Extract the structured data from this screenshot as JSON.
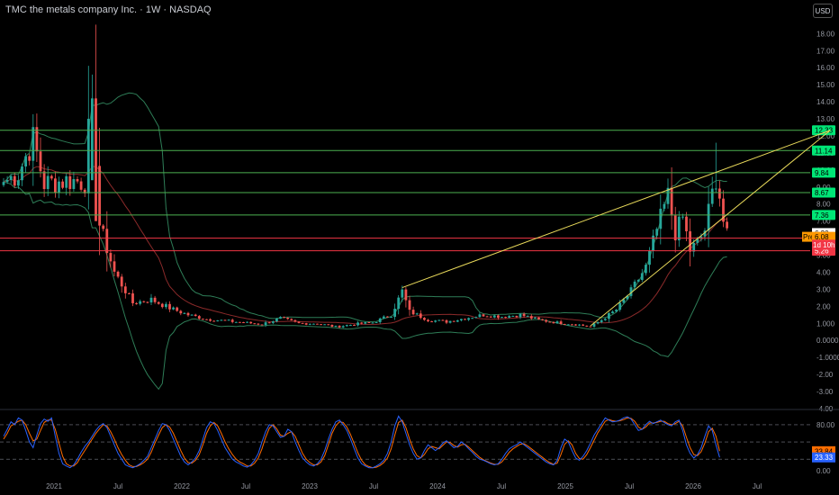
{
  "header": {
    "title": "TMC the metals company Inc. · 1W · NASDAQ",
    "currency_button": "USD"
  },
  "colors": {
    "background": "#000000",
    "level_line": "#4caf50",
    "level_label_bg": "#00e676",
    "red_line": "#f23645",
    "trend_line": "#e8d95a",
    "candle_up": "#26a69a",
    "candle_down": "#ef5350",
    "bb_band": "#2e7d57",
    "basis": "#8b2a2a",
    "stoch_k": "#2962ff",
    "stoch_d": "#ff6d00",
    "pre_label": "#ff9800"
  },
  "chart_data": {
    "type": "candlestick",
    "timeframe": "1W",
    "x_ticks": [
      "2021",
      "Jul",
      "2022",
      "Jul",
      "2023",
      "Jul",
      "2024",
      "Jul",
      "2025",
      "Jul",
      "2026",
      "Jul"
    ],
    "y_ticks": [
      "18.00",
      "17.00",
      "16.00",
      "15.00",
      "14.00",
      "13.00",
      "12.00",
      "11.00",
      "10.00",
      "9.00",
      "8.00",
      "7.00",
      "6.00",
      "5.00",
      "4.00",
      "3.00",
      "2.00",
      "1.000",
      "0.0000",
      "-1.0000",
      "-2.00",
      "-3.00",
      "-4.00"
    ],
    "ylim": [
      -4,
      18.6
    ],
    "price_path": [
      [
        0,
        9.3
      ],
      [
        4,
        9.8
      ],
      [
        8,
        11.8
      ],
      [
        11,
        9.2
      ],
      [
        14,
        9.3
      ],
      [
        18,
        9.4
      ],
      [
        22,
        9.3
      ],
      [
        24,
        15.0
      ],
      [
        26,
        6.8
      ],
      [
        30,
        4.0
      ],
      [
        35,
        2.2
      ],
      [
        40,
        2.4
      ],
      [
        45,
        1.9
      ],
      [
        50,
        1.5
      ],
      [
        55,
        1.25
      ],
      [
        60,
        1.15
      ],
      [
        65,
        1.05
      ],
      [
        70,
        0.95
      ],
      [
        75,
        1.3
      ],
      [
        80,
        1.0
      ],
      [
        85,
        1.0
      ],
      [
        90,
        0.8
      ],
      [
        95,
        0.95
      ],
      [
        100,
        1.05
      ],
      [
        105,
        1.5
      ],
      [
        108,
        2.9
      ],
      [
        110,
        1.7
      ],
      [
        115,
        1.2
      ],
      [
        120,
        1.1
      ],
      [
        125,
        1.3
      ],
      [
        130,
        1.5
      ],
      [
        135,
        1.4
      ],
      [
        140,
        1.5
      ],
      [
        145,
        1.2
      ],
      [
        150,
        1.05
      ],
      [
        155,
        0.95
      ],
      [
        159,
        0.8
      ],
      [
        162,
        1.2
      ],
      [
        166,
        1.8
      ],
      [
        170,
        2.9
      ],
      [
        174,
        4.3
      ],
      [
        177,
        6.5
      ],
      [
        180,
        8.5
      ],
      [
        182,
        6.3
      ],
      [
        184,
        7.2
      ],
      [
        186,
        5.3
      ],
      [
        188,
        5.7
      ],
      [
        190,
        6.5
      ],
      [
        192,
        8.6
      ],
      [
        193,
        9.6
      ],
      [
        194,
        8.5
      ],
      [
        195,
        7.0
      ],
      [
        196,
        6.1
      ]
    ],
    "horizontal_levels": [
      {
        "label": "12.33",
        "value": 12.33
      },
      {
        "label": "11.14",
        "value": 11.14
      },
      {
        "label": "9.84",
        "value": 9.84
      },
      {
        "label": "8.67",
        "value": 8.67
      },
      {
        "label": "7.36",
        "value": 7.36
      }
    ],
    "red_levels": [
      {
        "label": "6.00",
        "value": 6.0
      },
      {
        "label": "5.26",
        "value": 5.26
      }
    ],
    "price_labels": [
      {
        "label": "6.30",
        "value": 6.3,
        "style": "white"
      },
      {
        "label": "6.08",
        "value": 6.08,
        "style": "pre",
        "tag": "Pre"
      },
      {
        "label": "1d 10h",
        "value": 5.62,
        "style": "countdown"
      }
    ],
    "trend_lines": [
      {
        "from": [
          108,
          3.1
        ],
        "to": [
          224,
          12.33
        ]
      },
      {
        "from": [
          159,
          0.85
        ],
        "to": [
          224,
          12.33
        ]
      }
    ],
    "stochastic": {
      "ylim": [
        -8,
        105
      ],
      "ticks": [
        "80.00",
        "20.00",
        "0.00"
      ],
      "guides": [
        80,
        50,
        20
      ],
      "k_label": "23.33",
      "d_label": "33.84",
      "k": [
        60,
        72,
        85,
        80,
        92,
        88,
        70,
        50,
        40,
        62,
        82,
        90,
        86,
        92,
        60,
        30,
        12,
        8,
        5,
        10,
        20,
        32,
        42,
        50,
        60,
        70,
        78,
        82,
        75,
        60,
        45,
        30,
        20,
        10,
        7,
        5,
        8,
        12,
        18,
        25,
        40,
        55,
        70,
        82,
        80,
        70,
        55,
        40,
        25,
        15,
        10,
        15,
        22,
        35,
        55,
        75,
        85,
        82,
        70,
        55,
        40,
        30,
        20,
        15,
        12,
        8,
        6,
        10,
        18,
        30,
        50,
        68,
        80,
        78,
        68,
        58,
        60,
        72,
        68,
        50,
        35,
        22,
        15,
        10,
        8,
        12,
        20,
        35,
        55,
        72,
        85,
        88,
        80,
        70,
        55,
        38,
        22,
        12,
        8,
        5,
        5,
        8,
        12,
        18,
        30,
        50,
        78,
        95,
        85,
        65,
        45,
        30,
        20,
        22,
        35,
        45,
        40,
        35,
        40,
        48,
        52,
        46,
        40,
        42,
        50,
        45,
        38,
        32,
        25,
        20,
        18,
        15,
        12,
        10,
        12,
        20,
        30,
        38,
        42,
        45,
        50,
        45,
        40,
        35,
        30,
        25,
        20,
        15,
        12,
        10,
        18,
        40,
        55,
        50,
        35,
        22,
        18,
        25,
        35,
        48,
        62,
        72,
        82,
        92,
        88,
        85,
        86,
        88,
        92,
        94,
        90,
        80,
        70,
        72,
        80,
        86,
        82,
        85,
        88,
        84,
        80,
        78,
        85,
        88,
        70,
        45,
        30,
        22,
        28,
        40,
        60,
        78,
        70,
        45,
        23
      ],
      "d": [
        55,
        65,
        78,
        82,
        86,
        88,
        80,
        65,
        52,
        55,
        70,
        84,
        88,
        88,
        72,
        48,
        25,
        12,
        8,
        8,
        14,
        25,
        35,
        45,
        55,
        65,
        73,
        80,
        78,
        68,
        55,
        40,
        28,
        18,
        10,
        7,
        7,
        10,
        14,
        20,
        32,
        48,
        62,
        75,
        80,
        76,
        65,
        50,
        35,
        22,
        14,
        13,
        18,
        28,
        45,
        65,
        78,
        84,
        78,
        65,
        50,
        38,
        28,
        20,
        15,
        12,
        8,
        8,
        13,
        22,
        38,
        58,
        74,
        80,
        73,
        62,
        60,
        65,
        68,
        60,
        45,
        30,
        20,
        14,
        10,
        10,
        15,
        26,
        45,
        65,
        78,
        85,
        84,
        76,
        63,
        47,
        31,
        18,
        10,
        7,
        5,
        6,
        9,
        14,
        22,
        38,
        62,
        84,
        88,
        75,
        55,
        38,
        26,
        22,
        28,
        38,
        42,
        40,
        38,
        44,
        50,
        49,
        44,
        41,
        45,
        46,
        41,
        35,
        29,
        23,
        19,
        16,
        13,
        11,
        11,
        15,
        23,
        32,
        38,
        42,
        46,
        47,
        43,
        38,
        33,
        28,
        23,
        18,
        14,
        11,
        13,
        28,
        46,
        52,
        45,
        30,
        21,
        20,
        28,
        40,
        53,
        66,
        76,
        86,
        89,
        87,
        86,
        87,
        89,
        92,
        91,
        86,
        76,
        72,
        76,
        83,
        83,
        84,
        86,
        86,
        82,
        80,
        82,
        86,
        78,
        58,
        40,
        28,
        26,
        33,
        48,
        68,
        74,
        60,
        33.84
      ]
    }
  }
}
